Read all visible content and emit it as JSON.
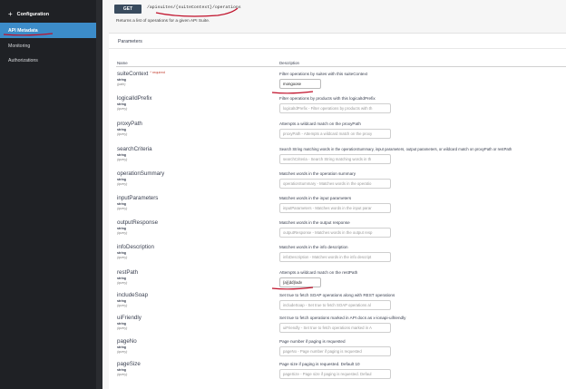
{
  "sidebar": {
    "config_label": "Configuration",
    "items": [
      {
        "label": "API Metadata",
        "active": true
      },
      {
        "label": "Monitoring",
        "active": false
      },
      {
        "label": "Authorizations",
        "active": false
      }
    ]
  },
  "endpoint": {
    "method": "GET",
    "path": "/apisuites/{suiteContext}/operations",
    "summary": "Returns a list of operations for a given API Suite."
  },
  "params_title": "Parameters",
  "columns": {
    "name": "Name",
    "description": "Description"
  },
  "required_label": "* required",
  "params": [
    {
      "name": "suiteContext",
      "type": "string",
      "in": "(path)",
      "required": true,
      "description": "Filter operations by suites with this suiteContext",
      "value": "mongoose",
      "placeholder": ""
    },
    {
      "name": "logicalIdPrefix",
      "type": "string",
      "in": "(query)",
      "required": false,
      "description": "Filter operations by products with this logicalIdPrefix",
      "value": "",
      "placeholder": "logicalIdPrefix - Filter operations by products with th"
    },
    {
      "name": "proxyPath",
      "type": "string",
      "in": "(query)",
      "required": false,
      "description": "Attempts a wildcard match on the proxyPath",
      "value": "",
      "placeholder": "proxyPath - Attempts a wildcard match on the proxy"
    },
    {
      "name": "searchCriteria",
      "type": "string",
      "in": "(query)",
      "required": false,
      "description": "Search String matching words in the operationSummary, input parameters, output parameters, or wildcard match on proxyPath or restPath",
      "value": "",
      "placeholder": "searchCriteria - Search String matching words in th"
    },
    {
      "name": "operationSummary",
      "type": "string",
      "in": "(query)",
      "required": false,
      "description": "Matches words in the operation summary",
      "value": "",
      "placeholder": "operationSummary - Matches words in the operatio"
    },
    {
      "name": "inputParameters",
      "type": "string",
      "in": "(query)",
      "required": false,
      "description": "Matches words in the input parameters",
      "value": "",
      "placeholder": "inputParameters - Matches words in the input parar"
    },
    {
      "name": "outputResponse",
      "type": "string",
      "in": "(query)",
      "required": false,
      "description": "Matches words in the output response",
      "value": "",
      "placeholder": "outputResponse - Matches words in the output resp"
    },
    {
      "name": "infoDescription",
      "type": "string",
      "in": "(query)",
      "required": false,
      "description": "Matches words in the info description",
      "value": "",
      "placeholder": "infoDescription - Matches words in the info descript"
    },
    {
      "name": "restPath",
      "type": "string",
      "in": "(query)",
      "required": false,
      "description": "Attempts a wildcard match on the restPath",
      "value": "{a}{dd}/adv",
      "placeholder": ""
    },
    {
      "name": "includeSoap",
      "type": "string",
      "in": "(query)",
      "required": false,
      "description": "Set true to fetch SOAP operations along with REST operations",
      "value": "",
      "placeholder": "includeSoap - Set true to fetch SOAP operations al"
    },
    {
      "name": "uiFriendly",
      "type": "string",
      "in": "(query)",
      "required": false,
      "description": "Set true to fetch operations marked in API docs as x-ionapi-uifriendly",
      "value": "",
      "placeholder": "uiFriendly - Set true to fetch operations marked in A"
    },
    {
      "name": "pageNo",
      "type": "string",
      "in": "(query)",
      "required": false,
      "description": "Page number if paging is requested",
      "value": "",
      "placeholder": "pageNo - Page number if paging is requested"
    },
    {
      "name": "pageSize",
      "type": "string",
      "in": "(query)",
      "required": false,
      "description": "Page size if paging is requested. Default 10",
      "value": "",
      "placeholder": "pageSize - Page size if paging is requested. Defaul"
    }
  ],
  "colors": {
    "sidebar_bg": "#1f2125",
    "active_bg": "#3c8cc9",
    "get_button": "#394b5e",
    "annotation": "#c0102a"
  }
}
